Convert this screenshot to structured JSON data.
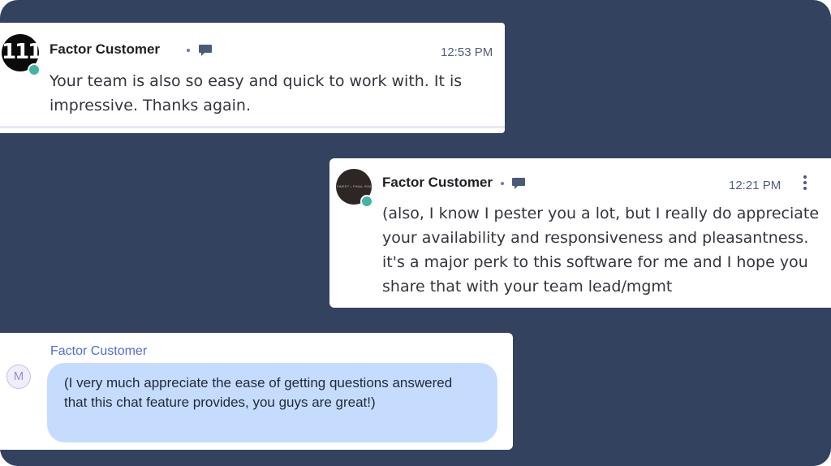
{
  "messages": [
    {
      "avatar_text": "111",
      "author": "Factor Customer",
      "time": "12:53 PM",
      "text": "Your team is also so easy and quick to work with. It is impressive. Thanks again."
    },
    {
      "avatar_text": "SWEET • FINAL RIM",
      "author": "Factor Customer",
      "time": "12:21 PM",
      "text": "(also, I know I pester you a lot, but I really do appreciate your availability and responsiveness and pleasantness. it's a major perk to this software for me and I hope you share that with your team lead/mgmt"
    },
    {
      "avatar_text": "M",
      "author": "Factor Customer",
      "text": "(I very much appreciate the ease of getting questions answered that this chat feature provides, you guys are great!)"
    }
  ],
  "icons": {
    "status": "online-status-dot",
    "channel": "chat-bubble-icon",
    "menu": "more-options-icon"
  },
  "colors": {
    "background": "#33425e",
    "online": "#45b3a2",
    "bubble": "#c6dcff",
    "author_link": "#4e6ed1"
  }
}
